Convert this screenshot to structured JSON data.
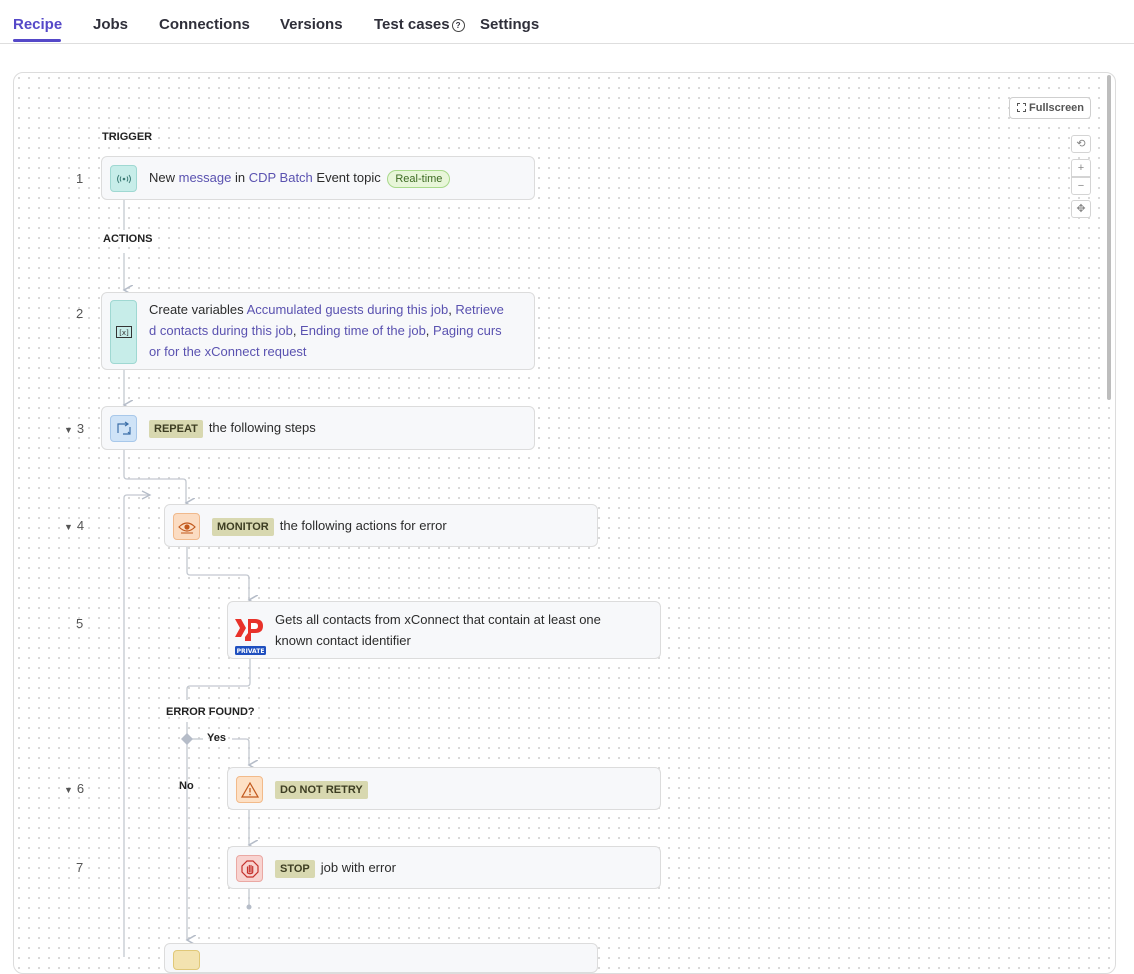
{
  "tabs": [
    {
      "label": "Recipe",
      "active": true
    },
    {
      "label": "Jobs"
    },
    {
      "label": "Connections"
    },
    {
      "label": "Versions"
    },
    {
      "label": "Test cases"
    },
    {
      "label": "Settings"
    }
  ],
  "toolbar": {
    "fullscreen_label": "Fullscreen",
    "icons": [
      "reset-view-icon",
      "zoom-in-icon",
      "zoom-out-icon",
      "fit-view-icon"
    ]
  },
  "sections": {
    "trigger": "TRIGGER",
    "actions": "ACTIONS",
    "error_found": "ERROR FOUND?",
    "yes": "Yes",
    "no": "No"
  },
  "steps": [
    {
      "num": "1",
      "text_before": "New ",
      "link1": "message",
      "text_mid": " in ",
      "link2": "CDP Batch",
      "text_after": " Event topic",
      "badge": "Real-time",
      "icon": "broadcast-icon"
    },
    {
      "num": "2",
      "prefix": "Create variables ",
      "vars": [
        "Accumulated guests during this job",
        "Retrieved contacts during this job",
        "Ending time of the job",
        "Paging cursor for the xConnect request"
      ],
      "line1_a": "Accumulated guests during this job",
      "line1_b": "Retrieve",
      "line2_a": "d contacts during this job",
      "line2_b": "Ending time of the job",
      "line2_c": "Paging curs",
      "line3": "or for the xConnect request",
      "icon": "variables-icon"
    },
    {
      "num": "3",
      "keyword": "REPEAT",
      "text": "the following steps",
      "icon": "repeat-icon"
    },
    {
      "num": "4",
      "keyword": "MONITOR",
      "text": "the following actions for error",
      "icon": "eye-icon"
    },
    {
      "num": "5",
      "line1": "Gets all contacts from xConnect that contain at least one",
      "line2": "known contact identifier",
      "badge": "PRIVATE",
      "icon": "xp-logo-icon"
    },
    {
      "num": "6",
      "keyword": "DO NOT RETRY",
      "icon": "warning-icon"
    },
    {
      "num": "7",
      "keyword": "STOP",
      "text": "job with error",
      "icon": "stop-hand-icon"
    }
  ]
}
